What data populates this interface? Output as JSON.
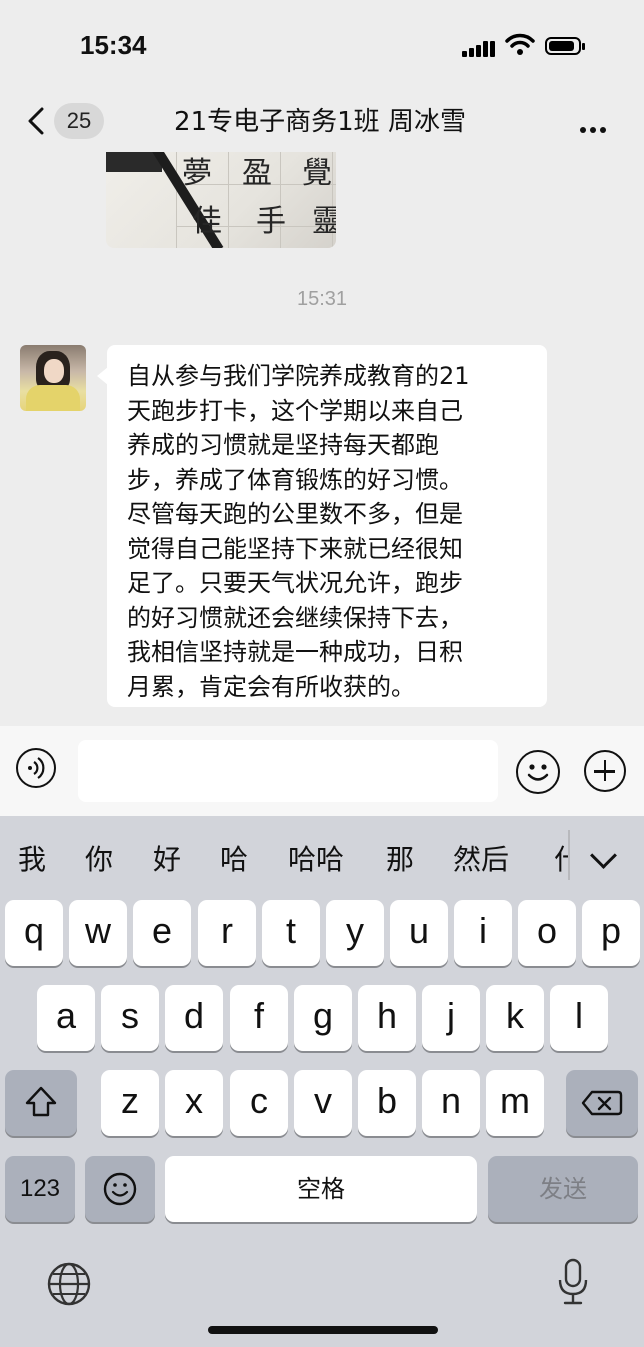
{
  "status_bar": {
    "time": "15:34"
  },
  "header": {
    "back_icon": "chevron-left-icon",
    "unread_count": "25",
    "title": "21专电子商务1班 周冰雪",
    "more_icon": "ellipsis-icon"
  },
  "chat": {
    "image_text": [
      "夢",
      "盈",
      "覺",
      "佳",
      "手",
      "靈"
    ],
    "timestamp": "15:31",
    "message_lines": [
      "自从参与我们学院养成教育的21",
      "天跑步打卡，这个学期以来自己",
      "养成的习惯就是坚持每天都跑",
      "步，养成了体育锻炼的好习惯。",
      "尽管每天跑的公里数不多，但是",
      "觉得自己能坚持下来就已经很知",
      "足了。只要天气状况允许，跑步",
      "的好习惯就还会继续保持下去，",
      "我相信坚持就是一种成功，日积",
      "月累，肯定会有所收获的。"
    ]
  },
  "input_bar": {
    "voice_icon": "voice-icon",
    "emoji_icon": "emoji-icon",
    "plus_icon": "plus-icon",
    "value": ""
  },
  "keyboard": {
    "candidates": [
      "我",
      "你",
      "好",
      "哈",
      "哈哈",
      "那",
      "然后",
      "什"
    ],
    "row1": [
      "q",
      "w",
      "e",
      "r",
      "t",
      "y",
      "u",
      "i",
      "o",
      "p"
    ],
    "row2": [
      "a",
      "s",
      "d",
      "f",
      "g",
      "h",
      "j",
      "k",
      "l"
    ],
    "row3": [
      "z",
      "x",
      "c",
      "v",
      "b",
      "n",
      "m"
    ],
    "numbers_label": "123",
    "space_label": "空格",
    "send_label": "发送",
    "shift_icon": "shift-icon",
    "delete_icon": "delete-icon",
    "emoji_key_icon": "emoji-icon",
    "globe_icon": "globe-icon",
    "mic_icon": "microphone-icon",
    "collapse_icon": "chevron-down-icon"
  }
}
